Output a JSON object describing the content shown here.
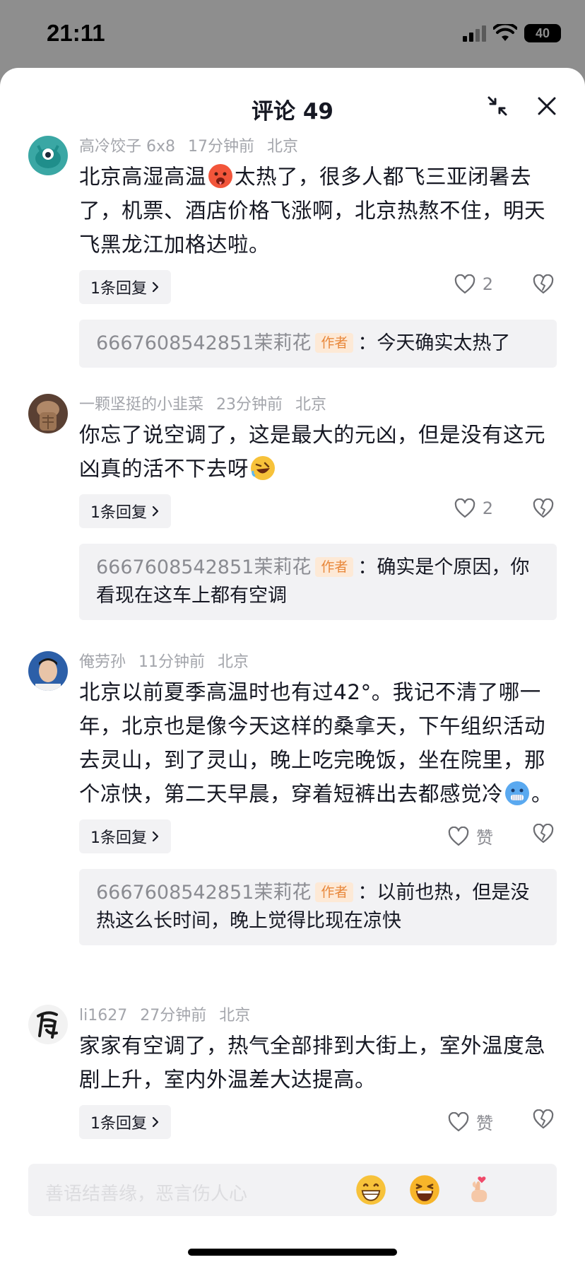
{
  "status_bar": {
    "time": "21:11",
    "battery": "40"
  },
  "header": {
    "title": "评论 49"
  },
  "comments": [
    {
      "username": "高冷饺子 6x8",
      "time": "17分钟前",
      "location": "北京",
      "text_a": "北京高湿高温",
      "text_b": "太热了，很多人都飞三亚闭暑去了，机票、酒店价格飞涨啊，北京热熬不住，明天飞黑龙江加格达啦。",
      "reply_chip": "1条回复",
      "likes": "2",
      "author_reply": {
        "user": "6667608542851茉莉花",
        "badge": "作者",
        "text": "：今天确实太热了"
      }
    },
    {
      "username": "一颗坚挺的小韭菜",
      "time": "23分钟前",
      "location": "北京",
      "text_a": "你忘了说空调了，这是最大的元凶，但是没有这元凶真的活不下去呀",
      "reply_chip": "1条回复",
      "likes": "2",
      "author_reply": {
        "user": "6667608542851茉莉花",
        "badge": "作者",
        "text": "：确实是个原因，你看现在这车上都有空调"
      }
    },
    {
      "username": "俺劳孙",
      "time": "11分钟前",
      "location": "北京",
      "text_a": "北京以前夏季高温时也有过42°。我记不清了哪一年，北京也是像今天这样的桑拿天，下午组织活动去灵山，到了灵山，晚上吃完晚饭，坐在院里，那个凉快，第二天早晨，穿着短裤出去都感觉冷",
      "text_b": "。",
      "reply_chip": "1条回复",
      "likes": "赞",
      "author_reply": {
        "user": "6667608542851茉莉花",
        "badge": "作者",
        "text": "：以前也热，但是没热这么长时间，晚上觉得比现在凉快"
      }
    },
    {
      "username": "li1627",
      "time": "27分钟前",
      "location": "北京",
      "text_a": "家家有空调了，热气全部排到大街上，室外温度急剧上升，室内外温差大达提高。",
      "reply_chip": "1条回复",
      "likes": "赞"
    }
  ],
  "input": {
    "placeholder": "善语结善缘，恶言伤人心"
  },
  "icons": {
    "collapse": "collapse-arrows-icon",
    "close": "close-icon",
    "heart": "heart-outline-icon",
    "dislike": "broken-heart-icon",
    "chevron": "chevron-right-icon"
  }
}
